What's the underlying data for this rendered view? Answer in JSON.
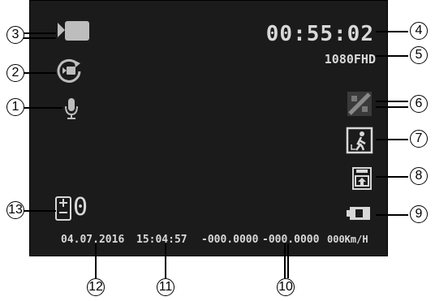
{
  "screen": {
    "time": "00:55:02",
    "resolution": "1080FHD",
    "exposure": "0",
    "date": "04.07.2016",
    "clock": "15:04:57",
    "latitude": "-000.0000",
    "longitude": "-000.0000",
    "speed": "000Km/H",
    "icons": {
      "camera": "video-camera-icon",
      "loop": "loop-recording-icon",
      "mic": "microphone-icon",
      "gps": "gps-satellite-icon",
      "motion": "motion-detection-icon",
      "sd": "sd-card-icon",
      "battery": "battery-icon",
      "ev": "exposure-icon"
    }
  },
  "callouts": [
    "1",
    "2",
    "3",
    "4",
    "5",
    "6",
    "7",
    "8",
    "9",
    "10",
    "11",
    "12",
    "13"
  ],
  "colors": {
    "screen": "#1b1b1b",
    "text": "#d8d8d8",
    "callout": "#000000"
  }
}
